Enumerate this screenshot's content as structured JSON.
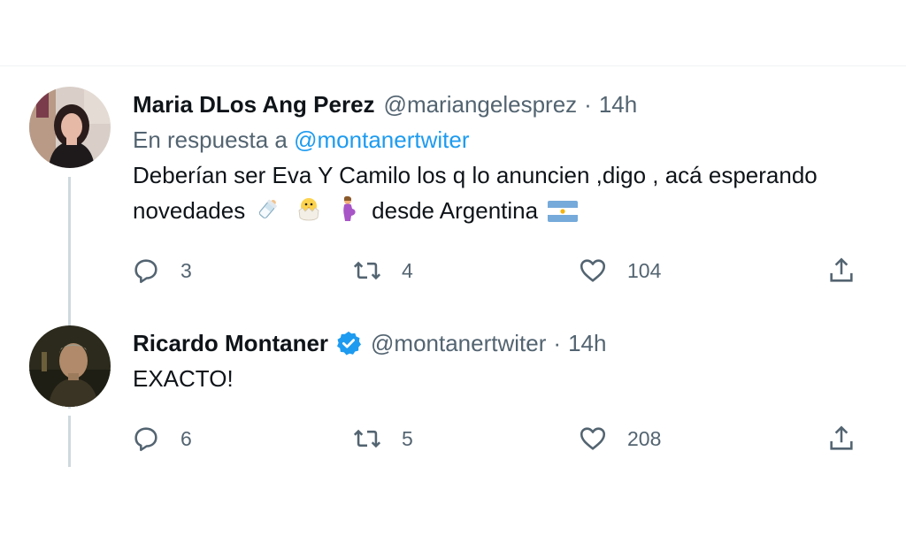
{
  "tweets": [
    {
      "author_name": "Maria DLos Ang Perez",
      "handle": "@mariangelesprez",
      "separator": "·",
      "time": "14h",
      "reply_prefix": "En respuesta a",
      "reply_mention": "@montanertwiter",
      "text_line1": "Deberían ser Eva Y Camilo los q lo anuncien ,digo , acá esperando",
      "text_line2_start": "novedades",
      "text_line2_end": "desde Argentina",
      "emojis": [
        "baby-bottle-icon",
        "hatching-chick-icon",
        "pregnant-woman-icon",
        "argentina-flag-icon"
      ],
      "replies": "3",
      "retweets": "4",
      "likes": "104",
      "verified": false
    },
    {
      "author_name": "Ricardo Montaner",
      "handle": "@montanertwiter",
      "separator": "·",
      "time": "14h",
      "text_line1": "EXACTO!",
      "replies": "6",
      "retweets": "5",
      "likes": "208",
      "verified": true
    }
  ],
  "colors": {
    "link": "#1d9bf0",
    "secondary_text": "#536471",
    "primary_text": "#0f1419",
    "thread_line": "#cfd9de"
  }
}
